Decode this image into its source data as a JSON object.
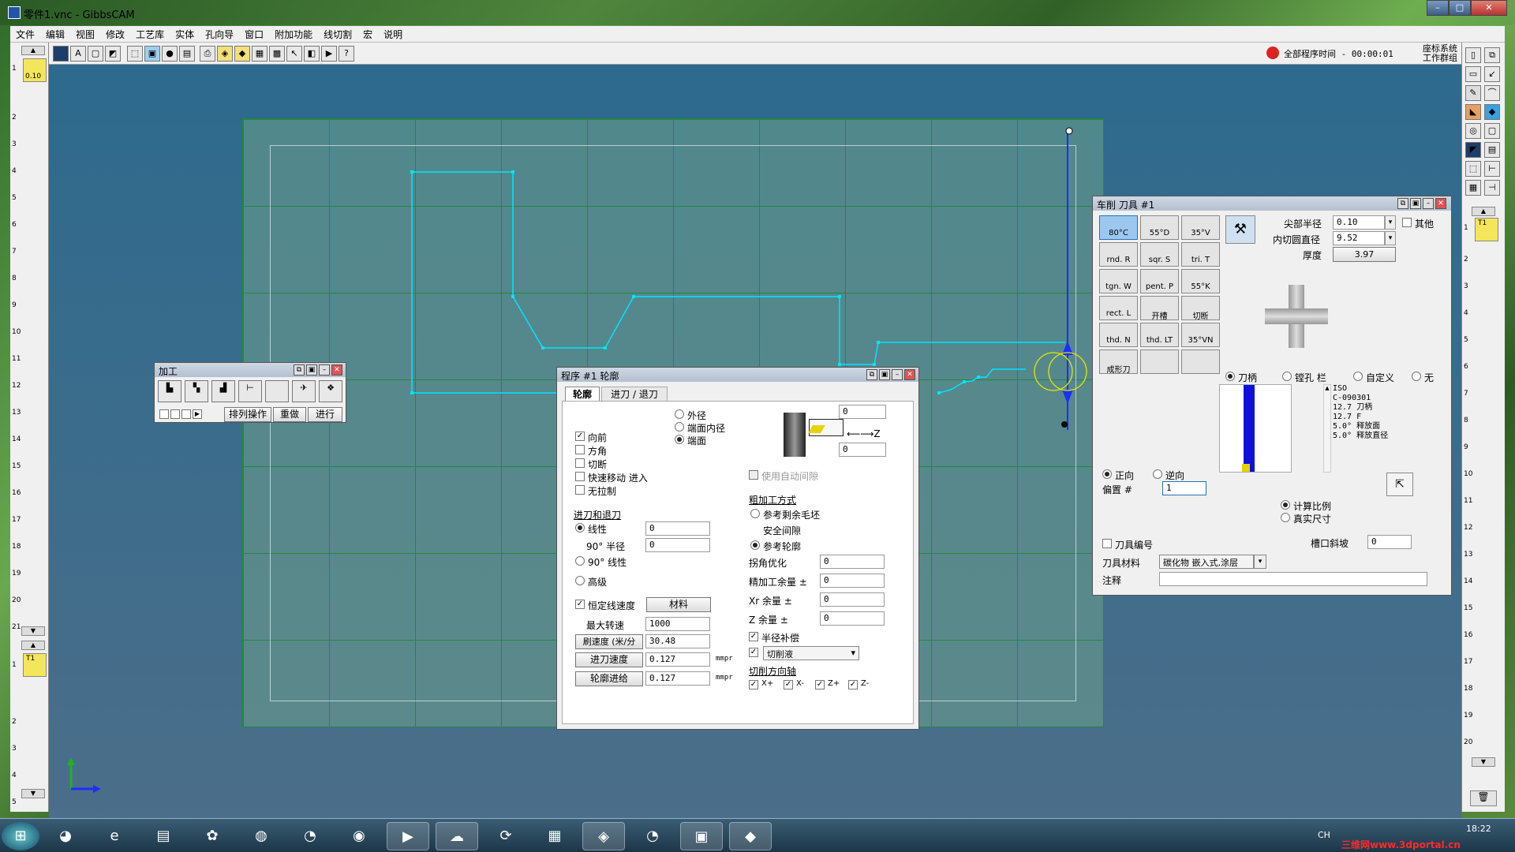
{
  "app": {
    "title": "零件1.vnc - GibbsCAM"
  },
  "menu": [
    "文件",
    "编辑",
    "视图",
    "修改",
    "工艺库",
    "实体",
    "孔向导",
    "窗口",
    "附加功能",
    "线切割",
    "宏",
    "说明"
  ],
  "status": {
    "program_time": "全部程序时间 - 00:00:01",
    "coord_label": "座标系统",
    "work_label": "工作群组"
  },
  "left_ruler": {
    "tool_value": "0.10",
    "numbers": [
      "1",
      "2",
      "3",
      "4",
      "5",
      "6",
      "7",
      "8",
      "9",
      "10",
      "11",
      "12",
      "13",
      "14",
      "15",
      "16",
      "17",
      "18",
      "19",
      "20",
      "21"
    ],
    "numbers2": [
      "1",
      "2",
      "3",
      "4",
      "5"
    ],
    "tool2": "T1"
  },
  "right_ruler": {
    "numbers": [
      "1",
      "2",
      "3",
      "4",
      "5",
      "6",
      "7",
      "8",
      "9",
      "10",
      "11",
      "12",
      "13",
      "14",
      "15",
      "16",
      "17",
      "18",
      "19",
      "20"
    ],
    "tool": "T1"
  },
  "machining": {
    "title": "加工",
    "buttons": [
      "排列操作",
      "重做",
      "进行"
    ]
  },
  "program": {
    "title": "程序 #1 轮廓",
    "tabs": [
      "轮廓",
      "进刀 / 退刀"
    ],
    "radios_top": [
      "外径",
      "端面内径",
      "端面"
    ],
    "checks": [
      "向前",
      "方角",
      "切断",
      "快速移动 进入",
      "无拉制"
    ],
    "auto_gap": "使用自动间隙",
    "diag_val_top": "0",
    "diag_val_bottom": "0",
    "diag_axis": "Z",
    "entry_section": "进刀和退刀",
    "linear": "线性",
    "linear_val": "0",
    "deg_radius": "90°  半径",
    "radius_val": "0",
    "deg_linear": "90°  线性",
    "advanced": "高级",
    "rough_title": "粗加工方式",
    "ref_stock": "参考剩余毛坯",
    "safe_gap": "安全间隙",
    "ref_contour": "参考轮廓",
    "corner_opt": "拐角优化",
    "corner_val": "0",
    "finish_allow": "精加工余量 ±",
    "finish_val": "0",
    "xr_allow": "Xr 余量 ±",
    "xr_val": "0",
    "z_allow": "Z 余量 ±",
    "z_val": "0",
    "css": "恒定线速度",
    "material": "材料",
    "max_rpm": "最大转速",
    "max_rpm_val": "1000",
    "surface_speed": "刷速度 (米/分",
    "surface_val": "30.48",
    "feed_in": "进刀速度",
    "feed_in_val": "0.127",
    "feed_contour": "轮廓进给",
    "feed_contour_val": "0.127",
    "unit": "mmpr",
    "radius_comp": "半径补偿",
    "coolant": "切削液",
    "cut_dir": "切削方向轴",
    "axes": [
      "X+",
      "X-",
      "Z+",
      "Z-"
    ]
  },
  "tool_panel": {
    "title": "车削 刀具 #1",
    "tools": [
      "80°C",
      "55°D",
      "35°V",
      "rnd. R",
      "sqr. S",
      "tri. T",
      "tgn. W",
      "pent. P",
      "55°K",
      "rect. L",
      "开槽",
      "切断",
      "thd. N",
      "thd. LT",
      "35°VN",
      "成形刀"
    ],
    "nose_radius": "尖部半径",
    "nose_val": "0.10",
    "ic": "内切圆直径",
    "ic_val": "9.52",
    "thickness": "厚度",
    "thickness_val": "3.97",
    "other": "其他",
    "holders": [
      "刀柄",
      "镗孔 栏",
      "自定义",
      "无"
    ],
    "iso_text": [
      "ISO",
      "C-090301",
      "12.7 刀柄",
      "12.7 F",
      "5.0° 释放面",
      "5.0° 释放直径"
    ],
    "forward": "正向",
    "reverse": "逆向",
    "offset": "偏置 #",
    "offset_val": "1",
    "calc_ratio": "计算比例",
    "true_size": "真实尺寸",
    "tool_num": "刀具编号",
    "groove": "槽口斜坡",
    "groove_val": "0",
    "material_lbl": "刀具材料",
    "material_val": "碳化物 嵌入式,涂层",
    "note": "注释"
  },
  "taskbar": {
    "time": "18:22",
    "lang": "CH",
    "watermark": "三维网www.3dportal.cn"
  },
  "colors": {
    "contour": "#00e5ff",
    "grid": "#1e8a3c",
    "axis": "#1a2fff"
  }
}
